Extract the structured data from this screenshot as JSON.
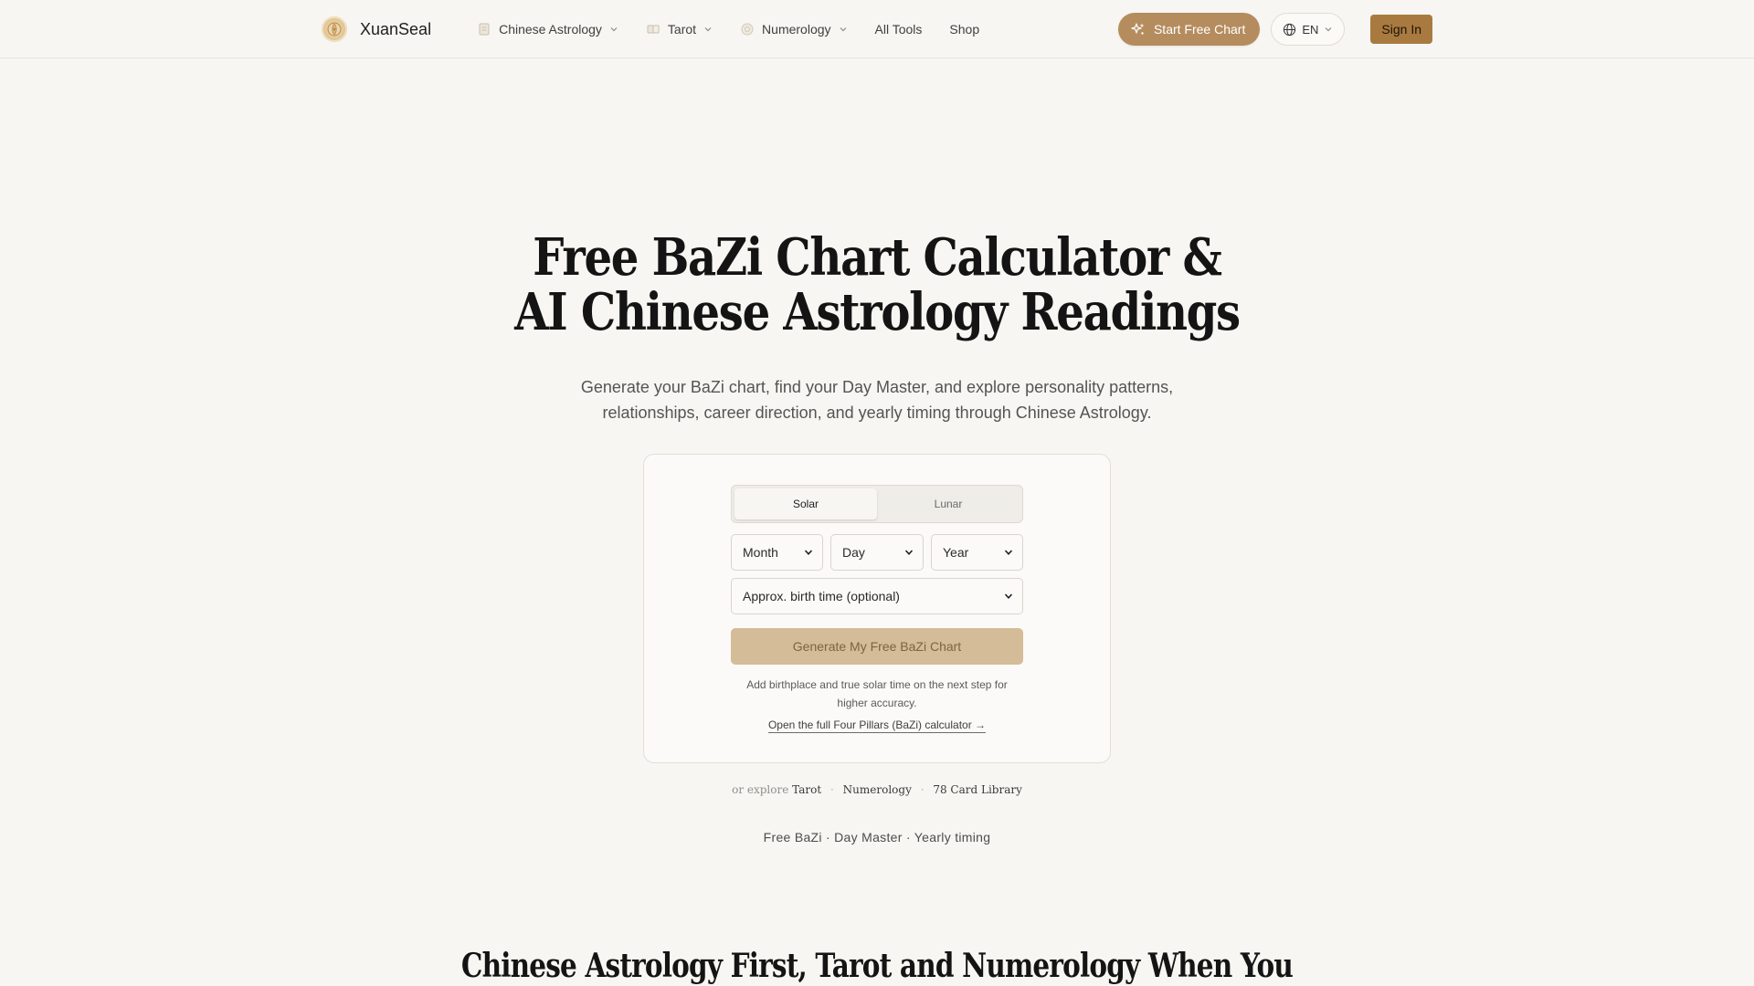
{
  "brand": {
    "name": "XuanSeal"
  },
  "nav": {
    "items": [
      {
        "label": "Chinese Astrology",
        "icon": "scroll-icon",
        "dropdown": true
      },
      {
        "label": "Tarot",
        "icon": "tarot-card-icon",
        "dropdown": true
      },
      {
        "label": "Numerology",
        "icon": "numerology-icon",
        "dropdown": true
      },
      {
        "label": "All Tools",
        "dropdown": false
      },
      {
        "label": "Shop",
        "dropdown": false
      }
    ]
  },
  "header": {
    "cta_label": "Start Free Chart",
    "lang_label": "EN",
    "signin_label": "Sign In"
  },
  "hero": {
    "title_line1": "Free BaZi Chart Calculator &",
    "title_line2": "AI Chinese Astrology Readings",
    "subtitle_line1": "Generate your BaZi chart, find your Day Master, and explore personality patterns,",
    "subtitle_line2": "relationships, career direction, and yearly timing through Chinese Astrology."
  },
  "form": {
    "calendar_options": [
      "Solar",
      "Lunar"
    ],
    "selected_calendar": "Solar",
    "month_value": "Month",
    "day_value": "Day",
    "year_value": "Year",
    "time_value": "Approx. birth time (optional)",
    "submit_label": "Generate My Free BaZi Chart",
    "hint_line1": "Add birthplace and true solar time on the next step for",
    "hint_line2": "higher accuracy.",
    "full_calc_link": "Open the full Four Pillars (BaZi) calculator →"
  },
  "explore": {
    "prefix": "or explore",
    "links": [
      "Tarot",
      "Numerology",
      "78 Card Library"
    ],
    "separator": "·"
  },
  "tagline": "Free BaZi · Day Master · Yearly timing",
  "section": {
    "title": "Chinese Astrology First, Tarot and Numerology When You"
  },
  "colors": {
    "background": "#f7f6f2",
    "accent": "#b58c5e",
    "signin": "#a97a3f",
    "submit_disabled": "#d4bc98"
  }
}
